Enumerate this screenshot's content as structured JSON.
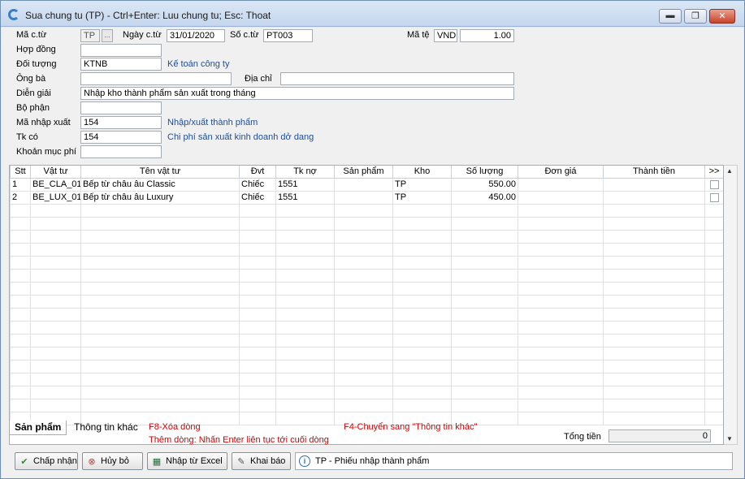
{
  "window": {
    "title": "Sua chung tu (TP) - Ctrl+Enter: Luu chung tu; Esc: Thoat",
    "minimize": "▬",
    "maximize": "❐",
    "close": "✕"
  },
  "header": {
    "ma_ct_label": "Mã c.từ",
    "ma_ct_value": "TP",
    "ellipsis": "...",
    "ngay_ct_label": "Ngày c.từ",
    "ngay_ct_value": "31/01/2020",
    "so_ct_label": "Số c.từ",
    "so_ct_value": "PT003",
    "ma_te_label": "Mã tệ",
    "ma_te_value": "VND",
    "ty_gia_value": "1.00",
    "hop_dong_label": "Hợp đồng",
    "hop_dong_value": "",
    "doi_tuong_label": "Đối tượng",
    "doi_tuong_value": "KTNB",
    "doi_tuong_name": "Kế toán công ty",
    "ong_ba_label": "Ông bà",
    "ong_ba_value": "",
    "dia_chi_label": "Địa chỉ",
    "dia_chi_value": "",
    "dien_giai_label": "Diễn giải",
    "dien_giai_value": "Nhập kho thành phẩm sản xuất trong tháng",
    "bo_phan_label": "Bộ phận",
    "bo_phan_value": "",
    "ma_nx_label": "Mã nhập xuất",
    "ma_nx_value": "154",
    "ma_nx_name": "Nhập/xuất thành phẩm",
    "tk_co_label": "Tk có",
    "tk_co_value": "154",
    "tk_co_name": "Chi phí sản xuất kinh doanh dở dang",
    "khoan_muc_label": "Khoản mục phí",
    "khoan_muc_value": ""
  },
  "grid": {
    "columns": [
      "Stt",
      "Vật tư",
      "Tên vật tư",
      "Đvt",
      "Tk nợ",
      "Sản phẩm",
      "Kho",
      "Số lượng",
      "Đơn giá",
      "Thành tiền",
      ">>"
    ],
    "rows": [
      {
        "stt": "1",
        "vat_tu": "BE_CLA_01",
        "ten": "Bếp từ châu âu Classic",
        "dvt": "Chiếc",
        "tk_no": "1551",
        "san_pham": "",
        "kho": "TP",
        "so_luong": "550.00",
        "don_gia": "",
        "thanh_tien": ""
      },
      {
        "stt": "2",
        "vat_tu": "BE_LUX_01",
        "ten": "Bếp từ châu âu Luxury",
        "dvt": "Chiếc",
        "tk_no": "1551",
        "san_pham": "",
        "kho": "TP",
        "so_luong": "450.00",
        "don_gia": "",
        "thanh_tien": ""
      }
    ]
  },
  "footer": {
    "tab_san_pham": "Sản phẩm",
    "tab_thong_tin_khac": "Thông tin khác",
    "hint_f8": "F8-Xóa dòng",
    "hint_them_dong": "Thêm dòng: Nhấn Enter liên tục tới cuối dòng",
    "hint_f4": "F4-Chuyển sang \"Thông tin khác\"",
    "tong_tien_label": "Tổng tiền",
    "tong_tien_value": "0"
  },
  "buttons": {
    "chap_nhan": "Chấp nhận",
    "huy_bo": "Hủy bỏ",
    "nhap_excel": "Nhập từ Excel",
    "khai_bao": "Khai báo"
  },
  "status": {
    "text": "TP - Phiếu nhập thành phẩm"
  },
  "colors": {
    "hint_blue": "#1c4f9a",
    "hint_red": "#d00000"
  }
}
